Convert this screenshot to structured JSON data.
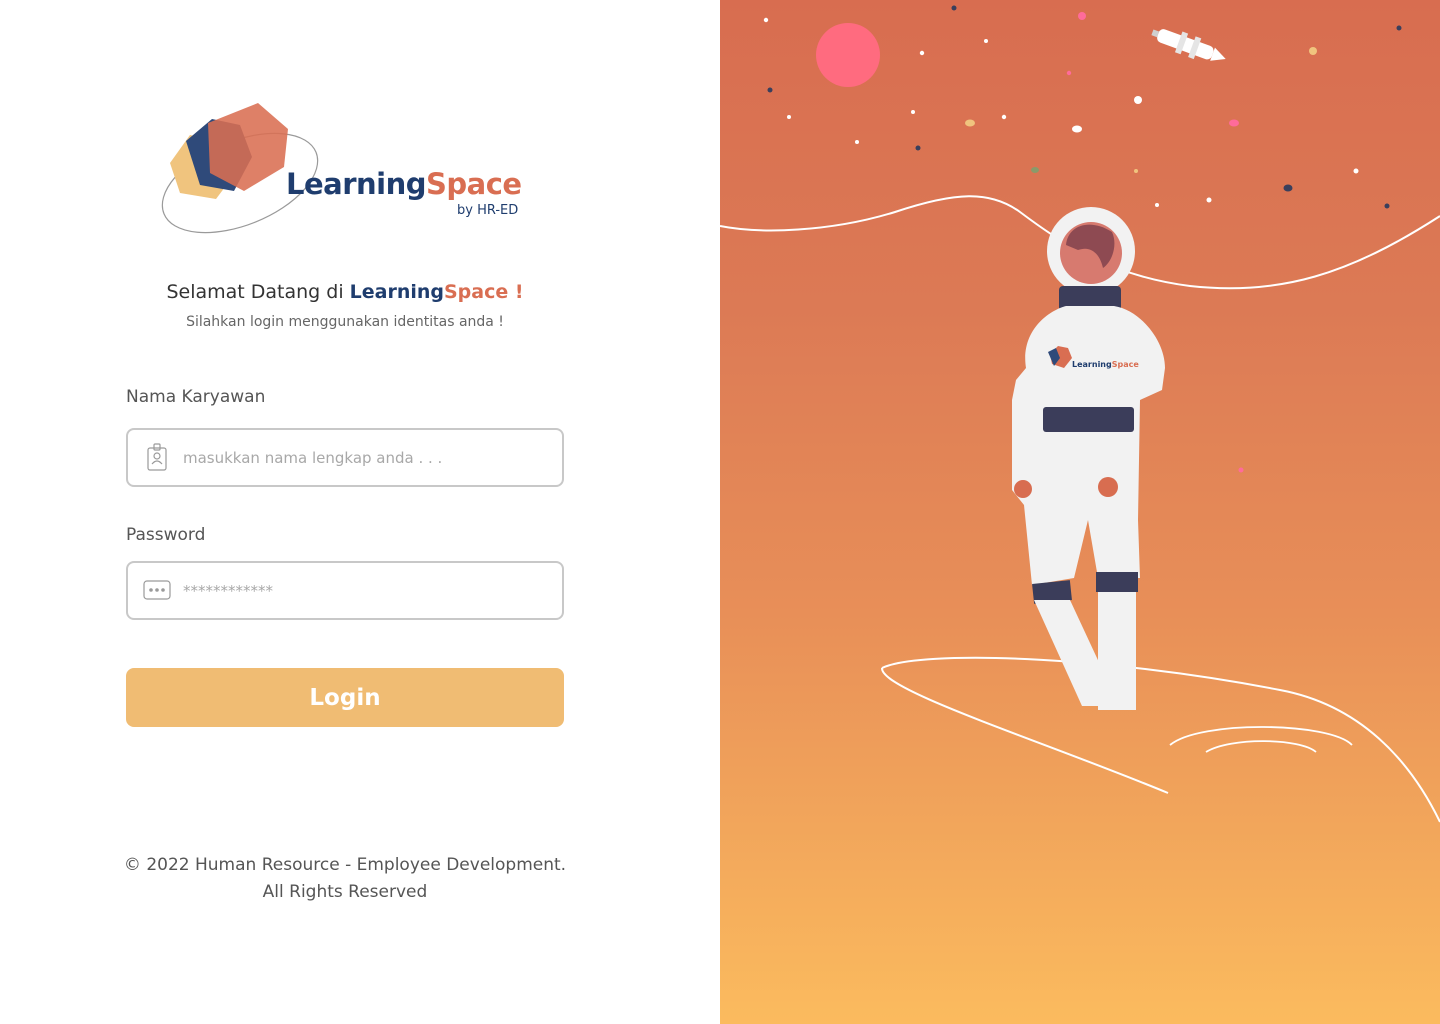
{
  "brand": {
    "name_part1": "Learning",
    "name_part2": "Space",
    "tagline": "by HR-ED",
    "colors": {
      "navy": "#1f3d6e",
      "coral": "#d96e52",
      "yellow": "#f0c47e"
    }
  },
  "welcome": {
    "prefix": "Selamat Datang di ",
    "brand1": "Learning",
    "brand2": "Space !",
    "subtitle": "Silahkan login menggunakan identitas anda !"
  },
  "form": {
    "name_label": "Nama Karyawan",
    "name_placeholder": "masukkan nama lengkap anda . . .",
    "name_icon": "id-badge-icon",
    "password_label": "Password",
    "password_placeholder": "************",
    "password_icon": "password-dots-icon",
    "login_label": "Login",
    "login_color": "#f0bc73"
  },
  "footer": {
    "line1": "© 2022 Human Resource - Employee Development.",
    "line2": "All Rights Reserved"
  },
  "illustration": {
    "description_icon": "astronaut-illustration",
    "suit_logo_part1": "Learning",
    "suit_logo_part2": "Space"
  }
}
